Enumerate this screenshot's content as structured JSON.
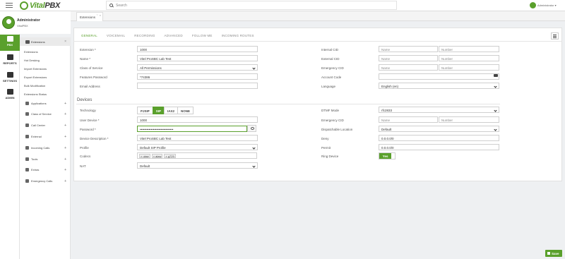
{
  "brand": {
    "name_prefix": "Vital",
    "name_suffix": "PBX"
  },
  "search": {
    "placeholder": "Search"
  },
  "user": {
    "name": "Administrator",
    "top_label": "Administrator ▾",
    "role": "VitalPBX"
  },
  "rail": [
    {
      "label": "PBX",
      "active": true
    },
    {
      "label": "REPORTS",
      "active": false
    },
    {
      "label": "SETTINGS",
      "active": false
    },
    {
      "label": "ADMIN",
      "active": false
    }
  ],
  "submenu": {
    "header": "Extensions",
    "links": [
      "Extensions",
      "Hot Desking",
      "Import Extensions",
      "Export Extensions",
      "Bulk Modification",
      "Extensions Status"
    ],
    "groups": [
      "Applications",
      "Class of Service",
      "Call Center",
      "External",
      "Incoming Calls",
      "Tools",
      "Extras",
      "Emergency Calls"
    ]
  },
  "tab": {
    "label": "Extensions",
    "pin": "☆",
    "close": "×"
  },
  "inner_tabs": [
    "GENERAL",
    "VOICEMAIL",
    "RECORDING",
    "ADVANCED",
    "FOLLOW ME",
    "INCOMING ROUTES"
  ],
  "form": {
    "extension": {
      "label": "Extension *",
      "value": "1000"
    },
    "name": {
      "label": "Name *",
      "value": "Vitel ProSBC Lab Test"
    },
    "class_of_service": {
      "label": "Class of Service",
      "value": "All Permissions"
    },
    "features_password": {
      "label": "Features Password",
      "value": "*74386"
    },
    "email": {
      "label": "Email Address",
      "value": ""
    },
    "internal_cid": {
      "label": "Internal CID",
      "name_ph": "Name",
      "number_ph": "Number"
    },
    "external_cid": {
      "label": "External CID",
      "name_ph": "Name",
      "number_ph": "Number"
    },
    "emergency_cid": {
      "label": "Emergency CID",
      "name_ph": "Name",
      "number_ph": "Number"
    },
    "account_code": {
      "label": "Account Code",
      "value": ""
    },
    "language": {
      "label": "Language",
      "value": "English (en)"
    }
  },
  "devices": {
    "section_title": "Devices",
    "technology": {
      "label": "Technology",
      "options": [
        "PJSIP",
        "SIP",
        "IAX2",
        "NONE"
      ],
      "selected": "SIP"
    },
    "user_device": {
      "label": "User Device *",
      "value": "1000"
    },
    "password": {
      "label": "Password *",
      "value": "••••••••••••••••••••••••••••••"
    },
    "device_description": {
      "label": "Device Description *",
      "value": "Vitel ProSBC Lab Test"
    },
    "profile": {
      "label": "Profile",
      "value": "Default SIP Profile"
    },
    "codecs": {
      "label": "Codecs",
      "values": [
        "× ulaw",
        "× alaw",
        "× g729"
      ]
    },
    "nat": {
      "label": "NAT",
      "value": "Default"
    },
    "dtmf_mode": {
      "label": "DTMF Mode",
      "value": "rfc2833"
    },
    "emergency_cid": {
      "label": "Emergency CID",
      "name_ph": "Name",
      "number_ph": "Number"
    },
    "dispatchable_location": {
      "label": "Dispatchable Location",
      "value": "Default"
    },
    "deny": {
      "label": "Deny",
      "value": "0.0.0.0/0"
    },
    "permit": {
      "label": "Permit",
      "value": "0.0.0.0/0"
    },
    "ring_device": {
      "label": "Ring Device",
      "value": "Yes"
    }
  },
  "actions": {
    "save": "Save"
  },
  "colors": {
    "accent": "#5aa02c"
  }
}
